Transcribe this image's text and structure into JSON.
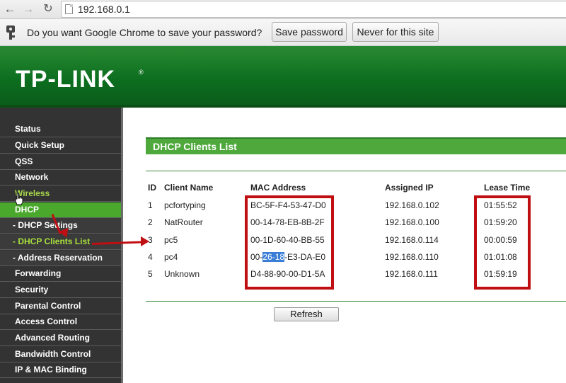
{
  "browser": {
    "url": "192.168.0.1",
    "back_icon": "←",
    "forward_icon": "→",
    "reload_icon": "↻"
  },
  "infobar": {
    "message": "Do you want Google Chrome to save your password?",
    "save_label": "Save password",
    "never_label": "Never for this site"
  },
  "header": {
    "logo": "TP-LINK",
    "logo_mark": "®"
  },
  "sidebar": {
    "items": [
      {
        "label": "Status"
      },
      {
        "label": "Quick Setup"
      },
      {
        "label": "QSS"
      },
      {
        "label": "Network"
      },
      {
        "label": "Wireless"
      },
      {
        "label": "DHCP"
      },
      {
        "label": "- DHCP Settings"
      },
      {
        "label": "- DHCP Clients List"
      },
      {
        "label": "- Address Reservation"
      },
      {
        "label": "Forwarding"
      },
      {
        "label": "Security"
      },
      {
        "label": "Parental Control"
      },
      {
        "label": "Access Control"
      },
      {
        "label": "Advanced Routing"
      },
      {
        "label": "Bandwidth Control"
      },
      {
        "label": "IP & MAC Binding"
      }
    ]
  },
  "main": {
    "title": "DHCP Clients List",
    "columns": [
      "ID",
      "Client Name",
      "MAC Address",
      "Assigned IP",
      "Lease Time"
    ],
    "rows": [
      {
        "id": "1",
        "name": "pcfortyping",
        "mac": "BC-5F-F4-53-47-D0",
        "ip": "192.168.0.102",
        "lease": "01:55:52"
      },
      {
        "id": "2",
        "name": "NatRouter",
        "mac": "00-14-78-EB-8B-2F",
        "ip": "192.168.0.100",
        "lease": "01:59:20"
      },
      {
        "id": "3",
        "name": "pc5",
        "mac": "00-1D-60-40-BB-55",
        "ip": "192.168.0.114",
        "lease": "00:00:59"
      },
      {
        "id": "4",
        "name": "pc4",
        "mac_prefix": "00-",
        "mac_selected": "26-18",
        "mac_suffix": "-E3-DA-E0",
        "ip": "192.168.0.110",
        "lease": "01:01:08"
      },
      {
        "id": "5",
        "name": "Unknown",
        "mac": "D4-88-90-00-D1-5A",
        "ip": "192.168.0.111",
        "lease": "01:59:19"
      }
    ],
    "refresh_label": "Refresh"
  },
  "colors": {
    "header_green": "#0c6e1f",
    "title_green": "#4ea83b",
    "active_green": "#4aa82d",
    "annotation_red": "#c00f12",
    "selection_blue": "#3a7dd6"
  }
}
